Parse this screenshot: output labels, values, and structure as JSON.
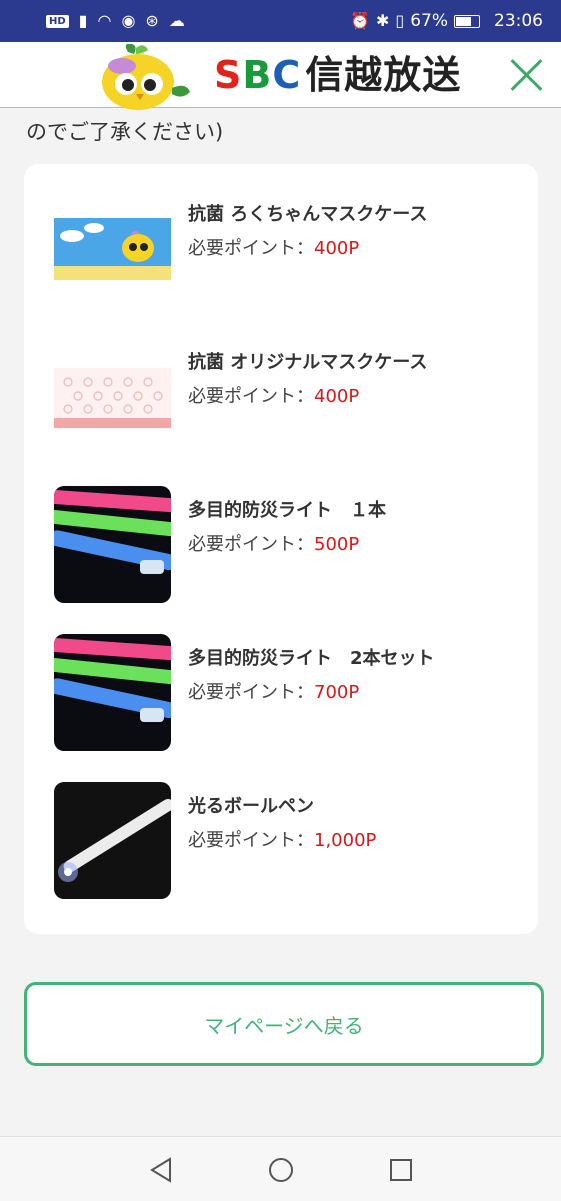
{
  "status_bar": {
    "hd_badge": "HD",
    "battery_percent": "67%",
    "time": "23:06",
    "icons": [
      "signal-icon",
      "wifi-icon",
      "eye-icon",
      "accessibility-icon",
      "cloud-upload-icon",
      "alarm-icon",
      "bluetooth-icon",
      "vibrate-icon",
      "battery-icon"
    ]
  },
  "header": {
    "logo_s": "S",
    "logo_b": "B",
    "logo_c": "C",
    "logo_jp": "信越放送",
    "close_icon": "close-icon"
  },
  "note": "のでご了承ください)",
  "items": [
    {
      "name": "抗菌 ろくちゃんマスクケース",
      "points_label": "必要ポイント：",
      "points_value": "400P"
    },
    {
      "name": "抗菌 オリジナルマスクケース",
      "points_label": "必要ポイント：",
      "points_value": "400P"
    },
    {
      "name": "多目的防災ライト　１本",
      "points_label": "必要ポイント：",
      "points_value": "500P"
    },
    {
      "name": "多目的防災ライト　2本セット",
      "points_label": "必要ポイント：",
      "points_value": "700P"
    },
    {
      "name": "光るボールペン",
      "points_label": "必要ポイント：",
      "points_value": "1,000P"
    }
  ],
  "mypage_button": "マイページへ戻る",
  "colors": {
    "accent_green": "#45b27a",
    "points_red": "#d41a1a",
    "status_bar": "#2b3a8f"
  },
  "nav": {
    "back": "back-icon",
    "home": "home-icon",
    "recents": "recents-icon"
  }
}
